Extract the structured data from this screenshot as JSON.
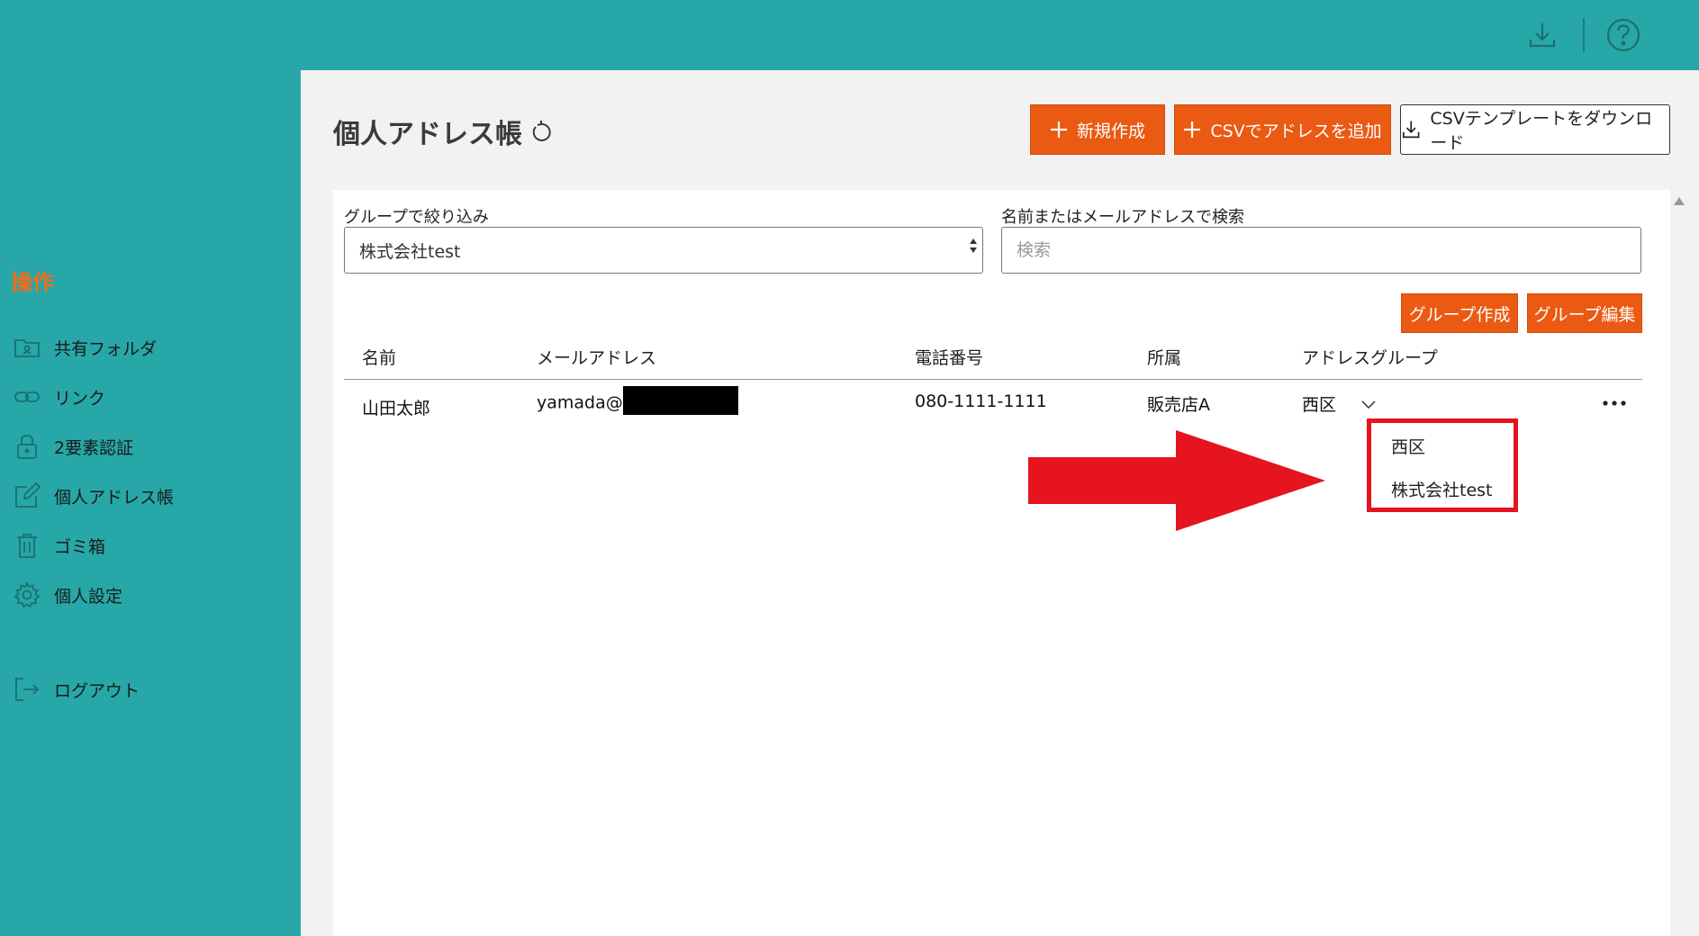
{
  "page_title": "個人アドレス帳",
  "toolbar": {
    "new_label": "新規作成",
    "csv_add_label": "CSVでアドレスを追加",
    "csv_template_label": "CSVテンプレートをダウンロード"
  },
  "sidebar": {
    "heading": "操作",
    "items": [
      {
        "label": "共有フォルダ",
        "icon": "folder-user-icon"
      },
      {
        "label": "リンク",
        "icon": "link-icon"
      },
      {
        "label": "2要素認証",
        "icon": "lock-icon"
      },
      {
        "label": "個人アドレス帳",
        "icon": "edit-icon"
      },
      {
        "label": "ゴミ箱",
        "icon": "trash-icon"
      },
      {
        "label": "個人設定",
        "icon": "gear-icon"
      },
      {
        "label": "ログアウト",
        "icon": "logout-icon"
      }
    ]
  },
  "filters": {
    "group_label": "グループで絞り込み",
    "group_value": "株式会社test",
    "search_label": "名前またはメールアドレスで検索",
    "search_placeholder": "検索"
  },
  "group_buttons": {
    "create_label": "グループ作成",
    "edit_label": "グループ編集"
  },
  "table": {
    "headers": [
      "名前",
      "メールアドレス",
      "電話番号",
      "所属",
      "アドレスグループ"
    ],
    "rows": [
      {
        "name": "山田太郎",
        "email_prefix": "yamada@",
        "phone": "080-1111-1111",
        "affiliation": "販売店A",
        "group": "西区"
      }
    ]
  },
  "group_dropdown": {
    "options": [
      "西区",
      "株式会社test"
    ]
  },
  "colors": {
    "teal": "#27a7a7",
    "accent_orange": "#ea5a13",
    "highlight_red": "#e5141e"
  }
}
